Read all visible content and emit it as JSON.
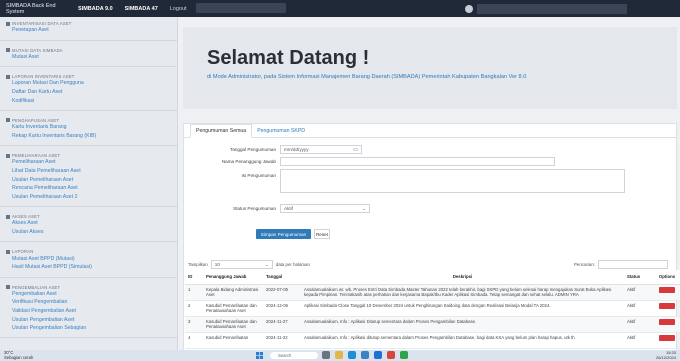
{
  "topbar": {
    "app_title": "SIMBADA Back End System",
    "nav": [
      "SIMBADA 9.0",
      "SIMBADA 47"
    ],
    "logout": "Logout"
  },
  "sidebar": {
    "groups": [
      {
        "head": "Inventarisasi Data Aset",
        "items": [
          "Penetapan Aset"
        ]
      },
      {
        "head": "Mutasi Data Simbada",
        "items": [
          "Mutasi Aset"
        ]
      },
      {
        "head": "Laporan Inventaris Aset",
        "items": [
          "Laporan Mutasi Dan Pengguna",
          "Daftar Dan Kartu Aset",
          "Kodifikasi"
        ]
      },
      {
        "head": "Penghapusan Aset",
        "items": [
          "Kartu Inventaris Barang",
          "Rekap Kartu Inventaris Barang (KIB)"
        ]
      },
      {
        "head": "Pemeliharaan Aset",
        "items": [
          "Pemeliharaan Aset",
          "Lihat Data Pemeliharaan Aset",
          "Usulan Pemeliharaan Aset",
          "Rencana Pemeliharaan Aset",
          "Usulan Pemeliharaan Aset 2"
        ]
      },
      {
        "head": "Akses Aset",
        "items": [
          "Akses Aset",
          "Usulan Akses"
        ]
      },
      {
        "head": "Laporan",
        "items": [
          "Mutasi Aset BPPD (Mutasi)",
          "Hasil Mutasi Aset BPPD (Simulasi)"
        ]
      },
      {
        "head": "Pengembalian Aset",
        "items": [
          "Pengembalian Aset",
          "Verifikasi Pengembalian",
          "Validasi Pengembalian Aset",
          "Usulan Pengembalian Aset",
          "Usulan Pengembalian Sebagian"
        ]
      }
    ]
  },
  "hero": {
    "title": "Selamat Datang !",
    "subtitle": "di Mode Administrator, pada Sistem Informasi Manajemen Barang Daerah (SIMBADA) Pemerintah Kabupaten Bangkalan Ver 8.0"
  },
  "card": {
    "tabs": [
      "Pengumuman Semua",
      "Pengumuman SKPD"
    ],
    "form": {
      "tanggal_label": "Tanggal Pengumuman",
      "tanggal_value": "mm/dd/yyyy",
      "nama_label": "Nama Penanggung Jawab",
      "isi_label": "Isi Pengumuman",
      "status_label": "Status Pengumuman",
      "status_value": "Aktif"
    },
    "save_button": "Simpan Pengumuman",
    "reset_button": "Reset",
    "show_label": "Tampilkan",
    "show_value": "10",
    "show_suffix": "data per halaman",
    "search_label": "Pencarian:",
    "columns": [
      "ID",
      "Penanggung Jawab",
      "Tanggal",
      "Deskripsi",
      "Status",
      "Options"
    ],
    "rows": [
      {
        "id": "1",
        "pj": "Kepala Bidang Administrasi Aset",
        "tanggal": "2022-07-05",
        "desk": "Assalamualaikum wr. wb. Proses Entri Data Simbada Master Tahunan 2022 telah berakhir, bagi SKPD yang belum selesai harap mengajukan Surat Buka Aplikasi kepada Pimpinan. Terimakasih atas perhatian dan kerjasama Bapak/Ibu Kader Aplikasi Simbada. Tetap semangat dan sehat selalu. ADMIN YRA",
        "status": "Aktif"
      },
      {
        "id": "2",
        "pj": "Kasubid Pemanfaatan dan Penatausahaan Aset",
        "tanggal": "2024-12-06",
        "desk": "Aplikasi Simbada Close Tanggal 10 Desember 2024 untuk Penghitungan Saldoing data dengan Realisasi Belanja Modal TA 2024.",
        "status": "Aktif"
      },
      {
        "id": "3",
        "pj": "Kasubid Pemanfaatan dan Penatausahaan Aset",
        "tanggal": "2024-11-27",
        "desk": "Assalamualaikum, Info : Aplikasi Ditutup sementara dalam Proses Pengambilan Database.",
        "status": "Aktif"
      },
      {
        "id": "4",
        "pj": "Kasubid Pemanfaatan",
        "tanggal": "2024-11-22",
        "desk": "Assalamualaikum, Info : Aplikasi ditutup sementara dalam Proses Pengambilan Database, bagi data KSA yang belum plan harap hapus. utk th",
        "status": "Aktif"
      }
    ]
  },
  "taskbar": {
    "weather_temp": "30°C",
    "weather_desc": "Sebagian cerah",
    "search": "Search",
    "time": "15:33",
    "date": "26/12/2024"
  },
  "colors": {
    "accent": "#2f7ab8",
    "danger": "#d73a3a",
    "topbar": "#1f2937"
  }
}
